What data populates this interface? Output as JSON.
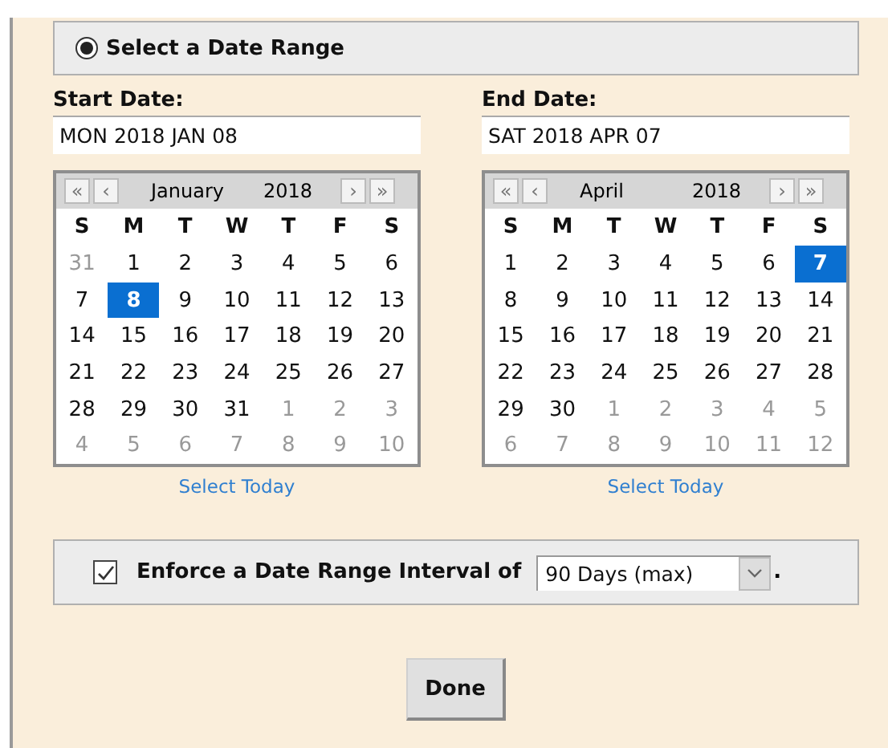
{
  "range_option": {
    "label": "Select a Date Range",
    "selected": true
  },
  "calendars": [
    {
      "label": "Start Date:",
      "value": "MON 2018 JAN 08",
      "nav": {
        "first": "«",
        "prev": "‹",
        "next": "›",
        "last": "»"
      },
      "month": "January",
      "year": "2018",
      "weekdays": [
        "S",
        "M",
        "T",
        "W",
        "T",
        "F",
        "S"
      ],
      "weeks": [
        [
          {
            "day": "31",
            "other": true,
            "selected": false
          },
          {
            "day": "1",
            "other": false,
            "selected": false
          },
          {
            "day": "2",
            "other": false,
            "selected": false
          },
          {
            "day": "3",
            "other": false,
            "selected": false
          },
          {
            "day": "4",
            "other": false,
            "selected": false
          },
          {
            "day": "5",
            "other": false,
            "selected": false
          },
          {
            "day": "6",
            "other": false,
            "selected": false
          }
        ],
        [
          {
            "day": "7",
            "other": false,
            "selected": false
          },
          {
            "day": "8",
            "other": false,
            "selected": true
          },
          {
            "day": "9",
            "other": false,
            "selected": false
          },
          {
            "day": "10",
            "other": false,
            "selected": false
          },
          {
            "day": "11",
            "other": false,
            "selected": false
          },
          {
            "day": "12",
            "other": false,
            "selected": false
          },
          {
            "day": "13",
            "other": false,
            "selected": false
          }
        ],
        [
          {
            "day": "14",
            "other": false,
            "selected": false
          },
          {
            "day": "15",
            "other": false,
            "selected": false
          },
          {
            "day": "16",
            "other": false,
            "selected": false
          },
          {
            "day": "17",
            "other": false,
            "selected": false
          },
          {
            "day": "18",
            "other": false,
            "selected": false
          },
          {
            "day": "19",
            "other": false,
            "selected": false
          },
          {
            "day": "20",
            "other": false,
            "selected": false
          }
        ],
        [
          {
            "day": "21",
            "other": false,
            "selected": false
          },
          {
            "day": "22",
            "other": false,
            "selected": false
          },
          {
            "day": "23",
            "other": false,
            "selected": false
          },
          {
            "day": "24",
            "other": false,
            "selected": false
          },
          {
            "day": "25",
            "other": false,
            "selected": false
          },
          {
            "day": "26",
            "other": false,
            "selected": false
          },
          {
            "day": "27",
            "other": false,
            "selected": false
          }
        ],
        [
          {
            "day": "28",
            "other": false,
            "selected": false
          },
          {
            "day": "29",
            "other": false,
            "selected": false
          },
          {
            "day": "30",
            "other": false,
            "selected": false
          },
          {
            "day": "31",
            "other": false,
            "selected": false
          },
          {
            "day": "1",
            "other": true,
            "selected": false
          },
          {
            "day": "2",
            "other": true,
            "selected": false
          },
          {
            "day": "3",
            "other": true,
            "selected": false
          }
        ],
        [
          {
            "day": "4",
            "other": true,
            "selected": false
          },
          {
            "day": "5",
            "other": true,
            "selected": false
          },
          {
            "day": "6",
            "other": true,
            "selected": false
          },
          {
            "day": "7",
            "other": true,
            "selected": false
          },
          {
            "day": "8",
            "other": true,
            "selected": false
          },
          {
            "day": "9",
            "other": true,
            "selected": false
          },
          {
            "day": "10",
            "other": true,
            "selected": false
          }
        ]
      ],
      "today_link": "Select Today"
    },
    {
      "label": "End Date:",
      "value": "SAT 2018 APR 07",
      "nav": {
        "first": "«",
        "prev": "‹",
        "next": "›",
        "last": "»"
      },
      "month": "April",
      "year": "2018",
      "weekdays": [
        "S",
        "M",
        "T",
        "W",
        "T",
        "F",
        "S"
      ],
      "weeks": [
        [
          {
            "day": "1",
            "other": false,
            "selected": false
          },
          {
            "day": "2",
            "other": false,
            "selected": false
          },
          {
            "day": "3",
            "other": false,
            "selected": false
          },
          {
            "day": "4",
            "other": false,
            "selected": false
          },
          {
            "day": "5",
            "other": false,
            "selected": false
          },
          {
            "day": "6",
            "other": false,
            "selected": false
          },
          {
            "day": "7",
            "other": false,
            "selected": true
          }
        ],
        [
          {
            "day": "8",
            "other": false,
            "selected": false
          },
          {
            "day": "9",
            "other": false,
            "selected": false
          },
          {
            "day": "10",
            "other": false,
            "selected": false
          },
          {
            "day": "11",
            "other": false,
            "selected": false
          },
          {
            "day": "12",
            "other": false,
            "selected": false
          },
          {
            "day": "13",
            "other": false,
            "selected": false
          },
          {
            "day": "14",
            "other": false,
            "selected": false
          }
        ],
        [
          {
            "day": "15",
            "other": false,
            "selected": false
          },
          {
            "day": "16",
            "other": false,
            "selected": false
          },
          {
            "day": "17",
            "other": false,
            "selected": false
          },
          {
            "day": "18",
            "other": false,
            "selected": false
          },
          {
            "day": "19",
            "other": false,
            "selected": false
          },
          {
            "day": "20",
            "other": false,
            "selected": false
          },
          {
            "day": "21",
            "other": false,
            "selected": false
          }
        ],
        [
          {
            "day": "22",
            "other": false,
            "selected": false
          },
          {
            "day": "23",
            "other": false,
            "selected": false
          },
          {
            "day": "24",
            "other": false,
            "selected": false
          },
          {
            "day": "25",
            "other": false,
            "selected": false
          },
          {
            "day": "26",
            "other": false,
            "selected": false
          },
          {
            "day": "27",
            "other": false,
            "selected": false
          },
          {
            "day": "28",
            "other": false,
            "selected": false
          }
        ],
        [
          {
            "day": "29",
            "other": false,
            "selected": false
          },
          {
            "day": "30",
            "other": false,
            "selected": false
          },
          {
            "day": "1",
            "other": true,
            "selected": false
          },
          {
            "day": "2",
            "other": true,
            "selected": false
          },
          {
            "day": "3",
            "other": true,
            "selected": false
          },
          {
            "day": "4",
            "other": true,
            "selected": false
          },
          {
            "day": "5",
            "other": true,
            "selected": false
          }
        ],
        [
          {
            "day": "6",
            "other": true,
            "selected": false
          },
          {
            "day": "7",
            "other": true,
            "selected": false
          },
          {
            "day": "8",
            "other": true,
            "selected": false
          },
          {
            "day": "9",
            "other": true,
            "selected": false
          },
          {
            "day": "10",
            "other": true,
            "selected": false
          },
          {
            "day": "11",
            "other": true,
            "selected": false
          },
          {
            "day": "12",
            "other": true,
            "selected": false
          }
        ]
      ],
      "today_link": "Select Today"
    }
  ],
  "interval": {
    "label": "Enforce a Date Range Interval of",
    "checked": true,
    "value": "90 Days (max)",
    "suffix": "."
  },
  "done_button": "Done"
}
